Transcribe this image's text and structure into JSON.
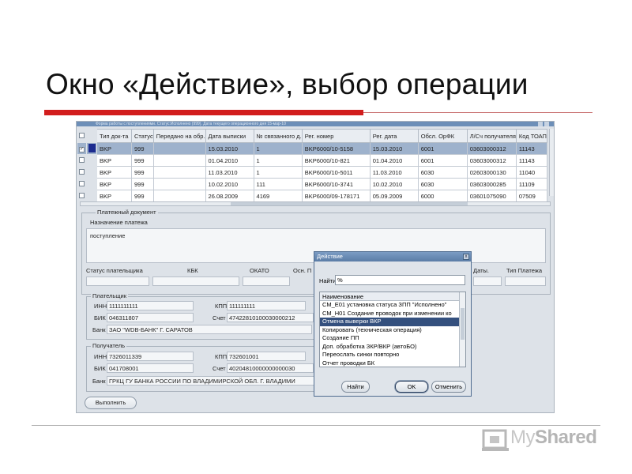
{
  "slide": {
    "title": "Окно «Действие», выбор операции",
    "logo_text_a": "My",
    "logo_text_b": "Shared"
  },
  "window": {
    "title": "Форма работы с поступлениями. Статус:Исполнено (999). Дата текущего операционного дня 15-мар-10"
  },
  "grid": {
    "columns": [
      "Тип док-та",
      "Статус",
      "Передано на обр.",
      "Дата выписки",
      "№ связанного д.",
      "Рег. номер",
      "Рег. дата",
      "Обсл. ОрФК",
      "Л/Сч получателя",
      "Код ТОАП"
    ],
    "rows": [
      {
        "checked": true,
        "selected": true,
        "cells": [
          "BKP",
          "999",
          "",
          "15.03.2010",
          "1",
          "BKP6000/10-5158",
          "15.03.2010",
          "6001",
          "03603000312",
          "11143"
        ]
      },
      {
        "checked": false,
        "selected": false,
        "cells": [
          "BKP",
          "999",
          "",
          "01.04.2010",
          "1",
          "BKP6000/10-821",
          "01.04.2010",
          "6001",
          "03603000312",
          "11143"
        ]
      },
      {
        "checked": false,
        "selected": false,
        "cells": [
          "BKP",
          "999",
          "",
          "11.03.2010",
          "1",
          "BKP6000/10-5011",
          "11.03.2010",
          "6030",
          "02603000130",
          "11040"
        ]
      },
      {
        "checked": false,
        "selected": false,
        "cells": [
          "BKP",
          "999",
          "",
          "10.02.2010",
          "111",
          "BKP6000/10-3741",
          "10.02.2010",
          "6030",
          "03603000285",
          "11109"
        ]
      },
      {
        "checked": false,
        "selected": false,
        "cells": [
          "BKP",
          "999",
          "",
          "26.08.2009",
          "4169",
          "BKP6000/09-178171",
          "05.09.2009",
          "6000",
          "03601075090",
          "07509"
        ]
      }
    ]
  },
  "payment": {
    "section_title": "Платежный документ",
    "purpose_label": "Назначение платежа",
    "purpose_value": "поступление",
    "labels": {
      "payer_status": "Статус плательщика",
      "kbk": "КБК",
      "okato": "ОКАТО",
      "osn": "Осн. П",
      "daty": "Даты.",
      "pay_type": "Тип Платежа"
    }
  },
  "payer": {
    "title": "Плательщик",
    "inn_label": "ИНН",
    "inn": "1111111111",
    "kpp_label": "КПП",
    "kpp": "111111111",
    "bik_label": "БИК",
    "bik": "046311807",
    "account_label": "Счет",
    "account": "47422810100030000212",
    "bank_label": "Банк",
    "bank": "ЗАО \"WDB-БАНК\" Г. САРАТОВ"
  },
  "recipient": {
    "title": "Получатель",
    "inn_label": "ИНН",
    "inn": "7326011339",
    "kpp_label": "КПП",
    "kpp": "732601001",
    "bik_label": "БИК",
    "bik": "041708001",
    "account_label": "Счет",
    "account": "40204810000000000030",
    "bank_label": "Банк",
    "bank": "ГРКЦ ГУ БАНКА РОССИИ ПО ВЛАДИМИРСКОЙ ОБЛ. Г. ВЛАДИМИ"
  },
  "execute_button": "Выполнить",
  "dialog": {
    "title": "Действие",
    "close_glyph": "x",
    "find_label": "Найти",
    "find_value": "%",
    "list_header": "Наименование",
    "items": [
      {
        "label": "СМ_Е01 установка статуса ЗПП \"Исполнено\""
      },
      {
        "label": "СМ_Н01 Создание проводок при изменении ко"
      },
      {
        "label": "Отмена выверки ВКР",
        "selected": true
      },
      {
        "label": "Копировать (техническая операция)"
      },
      {
        "label": "Создание ПП"
      },
      {
        "label": "Доп. обработка ЗКР/ВКР (автоБО)"
      },
      {
        "label": "Переослать синки повторно"
      },
      {
        "label": "Отчет проводки БК"
      }
    ],
    "find_button": "Найти",
    "ok_button": "OK",
    "cancel_button": "Отменить"
  }
}
